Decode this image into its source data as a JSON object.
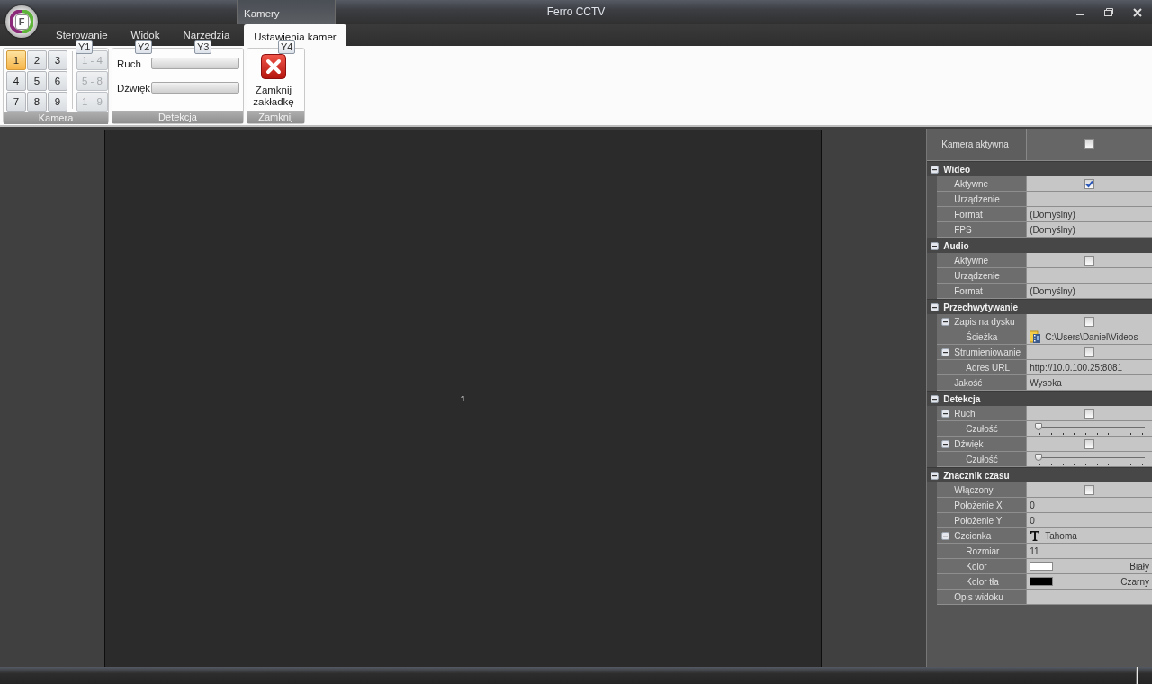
{
  "window": {
    "title": "Ferro CCTV",
    "logo": "F",
    "context_tab": "Kamery"
  },
  "tabs": [
    {
      "label": "Sterowanie",
      "selected": false
    },
    {
      "label": "Widok",
      "selected": false
    },
    {
      "label": "Narzedzia",
      "selected": false
    },
    {
      "label": "Ustawienia kamer",
      "selected": true
    }
  ],
  "ribbon": {
    "groups": [
      {
        "kind": "cameras",
        "title": "Kamera",
        "keytips": [
          "Y1"
        ],
        "cameras": [
          {
            "label": "1",
            "selected": true
          },
          {
            "label": "2",
            "selected": false
          },
          {
            "label": "3",
            "selected": false
          },
          {
            "label": "4",
            "selected": false
          },
          {
            "label": "5",
            "selected": false
          },
          {
            "label": "6",
            "selected": false
          },
          {
            "label": "7",
            "selected": false
          },
          {
            "label": "8",
            "selected": false
          },
          {
            "label": "9",
            "selected": false
          }
        ],
        "layouts": [
          {
            "label": "1 - 4",
            "disabled": true
          },
          {
            "label": "5 - 8",
            "disabled": true
          },
          {
            "label": "1 - 9",
            "disabled": true
          }
        ]
      },
      {
        "kind": "meters",
        "title": "Detekcja",
        "keytips": [
          "Y2",
          "Y3"
        ],
        "meters": [
          {
            "label": "Ruch",
            "level": 0
          },
          {
            "label": "Dźwięk",
            "level": 0
          }
        ]
      },
      {
        "kind": "close",
        "title": "Zamknij",
        "keytips": [
          "Y4"
        ],
        "button": "Zamknij zakładkę"
      }
    ]
  },
  "video": {
    "label": "1"
  },
  "properties": {
    "header": {
      "label": "Kamera aktywna",
      "checked": false
    },
    "categories": [
      {
        "label": "Wideo",
        "expanded": true,
        "rows": [
          {
            "label": "Aktywne",
            "kind": "checkbox",
            "checked": true
          },
          {
            "label": "Urządzenie",
            "kind": "text"
          },
          {
            "label": "Format",
            "kind": "text",
            "value": "(Domyślny)"
          },
          {
            "label": "FPS",
            "kind": "text",
            "value": "(Domyślny)"
          }
        ]
      },
      {
        "label": "Audio",
        "expanded": true,
        "rows": [
          {
            "label": "Aktywne",
            "kind": "checkbox",
            "checked": false
          },
          {
            "label": "Urządzenie",
            "kind": "text"
          },
          {
            "label": "Format",
            "kind": "text",
            "value": "(Domyślny)"
          }
        ]
      },
      {
        "label": "Przechwytywanie",
        "expanded": true,
        "rows": [
          {
            "label": "Zapis na dysku",
            "kind": "checkbox",
            "checked": false,
            "expanded": true,
            "children": [
              {
                "label": "Ścieżka",
                "kind": "path",
                "value": "C:\\Users\\Daniel\\Videos"
              }
            ]
          },
          {
            "label": "Strumieniowanie",
            "kind": "checkbox",
            "checked": false,
            "expanded": true,
            "children": [
              {
                "label": "Adres URL",
                "kind": "text",
                "value": "http://10.0.100.25:8081"
              }
            ]
          },
          {
            "label": "Jakość",
            "kind": "text",
            "value": "Wysoka"
          }
        ]
      },
      {
        "label": "Detekcja",
        "expanded": true,
        "rows": [
          {
            "label": "Ruch",
            "kind": "checkbox",
            "checked": false,
            "expanded": true,
            "children": [
              {
                "label": "Czułość",
                "kind": "slider",
                "level": 0
              }
            ]
          },
          {
            "label": "Dźwięk",
            "kind": "checkbox",
            "checked": false,
            "expanded": true,
            "children": [
              {
                "label": "Czułość",
                "kind": "slider",
                "level": 0
              }
            ]
          }
        ]
      },
      {
        "label": "Znacznik czasu",
        "expanded": true,
        "rows": [
          {
            "label": "Włączony",
            "kind": "checkbox",
            "checked": false
          },
          {
            "label": "Położenie X",
            "kind": "text",
            "value": "0"
          },
          {
            "label": "Położenie Y",
            "kind": "text",
            "value": "0"
          },
          {
            "label": "Czcionka",
            "kind": "font",
            "value": "Tahoma",
            "expanded": true,
            "children": [
              {
                "label": "Rozmiar",
                "kind": "text",
                "value": "11"
              },
              {
                "label": "Kolor",
                "kind": "color",
                "color": "#ffffff",
                "value": "Biały"
              },
              {
                "label": "Kolor tła",
                "kind": "color",
                "color": "#000000",
                "value": "Czarny"
              }
            ]
          },
          {
            "label": "Opis widoku",
            "kind": "text"
          }
        ]
      }
    ]
  }
}
